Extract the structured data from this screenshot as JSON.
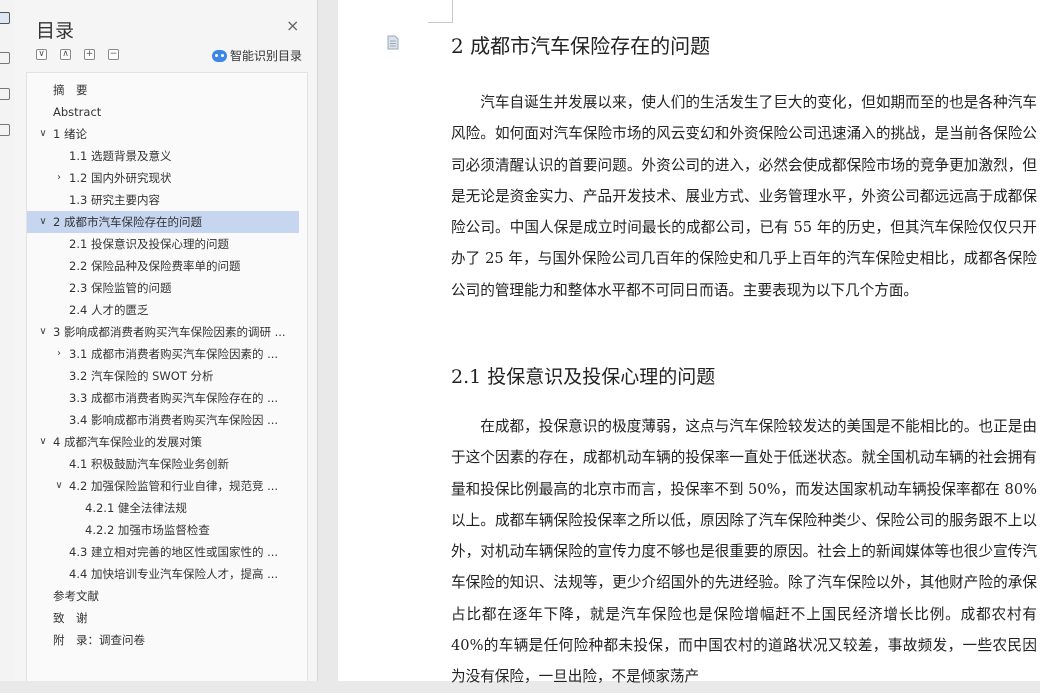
{
  "sidebar": {
    "title": "目录",
    "close_label": "×",
    "tools": [
      "∨",
      "∧",
      "+",
      "−"
    ],
    "smart_label": "智能识别目录",
    "toc": [
      {
        "label": "摘　要",
        "level": 0,
        "chevron": ""
      },
      {
        "label": "Abstract",
        "level": 0,
        "chevron": ""
      },
      {
        "label": "1 绪论",
        "level": 0,
        "chevron": "∨"
      },
      {
        "label": "1.1 选题背景及意义",
        "level": 1,
        "chevron": ""
      },
      {
        "label": "1.2 国内外研究现状",
        "level": 1,
        "chevron": "›"
      },
      {
        "label": "1.3 研究主要内容",
        "level": 1,
        "chevron": ""
      },
      {
        "label": "2 成都市汽车保险存在的问题",
        "level": 0,
        "chevron": "∨",
        "selected": true
      },
      {
        "label": "2.1 投保意识及投保心理的问题",
        "level": 1,
        "chevron": ""
      },
      {
        "label": "2.2 保险品种及保险费率单的问题",
        "level": 1,
        "chevron": ""
      },
      {
        "label": "2.3 保险监管的问题",
        "level": 1,
        "chevron": ""
      },
      {
        "label": "2.4 人才的匮乏",
        "level": 1,
        "chevron": ""
      },
      {
        "label": "3 影响成都消费者购买汽车保险因素的调研 ...",
        "level": 0,
        "chevron": "∨"
      },
      {
        "label": "3.1 成都市消费者购买汽车保险因素的 ...",
        "level": 1,
        "chevron": "›"
      },
      {
        "label": "3.2 汽车保险的 SWOT 分析",
        "level": 1,
        "chevron": ""
      },
      {
        "label": "3.3 成都市消费者购买汽车保险存在的 ...",
        "level": 1,
        "chevron": ""
      },
      {
        "label": "3.4 影响成都市消费者购买汽车保险因 ...",
        "level": 1,
        "chevron": ""
      },
      {
        "label": "4 成都汽车保险业的发展对策",
        "level": 0,
        "chevron": "∨"
      },
      {
        "label": "4.1 积极鼓励汽车保险业务创新",
        "level": 1,
        "chevron": ""
      },
      {
        "label": "4.2 加强保险监管和行业自律，规范竞 ...",
        "level": 1,
        "chevron": "∨"
      },
      {
        "label": "4.2.1 健全法律法规",
        "level": 2,
        "chevron": ""
      },
      {
        "label": "4.2.2 加强市场监督检查",
        "level": 2,
        "chevron": ""
      },
      {
        "label": "4.3 建立相对完善的地区性或国家性的 ...",
        "level": 1,
        "chevron": ""
      },
      {
        "label": "4.4 加快培训专业汽车保险人才，提高 ...",
        "level": 1,
        "chevron": ""
      },
      {
        "label": "参考文献",
        "level": 0,
        "chevron": ""
      },
      {
        "label": "致　谢",
        "level": 0,
        "chevron": ""
      },
      {
        "label": "附　录：调查问卷",
        "level": 0,
        "chevron": ""
      }
    ]
  },
  "document": {
    "heading1": "2 成都市汽车保险存在的问题",
    "para1": "汽车自诞生并发展以来，使人们的生活发生了巨大的变化，但如期而至的也是各种汽车风险。如何面对汽车保险市场的风云变幻和外资保险公司迅速涌入的挑战，是当前各保险公司必须清醒认识的首要问题。外资公司的进入，必然会使成都保险市场的竞争更加激烈，但是无论是资金实力、产品开发技术、展业方式、业务管理水平，外资公司都远远高于成都保险公司。中国人保是成立时间最长的成都公司，已有 55 年的历史，但其汽车保险仅仅只开办了 25 年，与国外保险公司几百年的保险史和几乎上百年的汽车保险史相比，成都各保险公司的管理能力和整体水平都不可同日而语。主要表现为以下几个方面。",
    "heading2": "2.1 投保意识及投保心理的问题",
    "para2": "在成都，投保意识的极度薄弱，这点与汽车保险较发达的美国是不能相比的。也正是由于这个因素的存在，成都机动车辆的投保率一直处于低迷状态。就全国机动车辆的社会拥有量和投保比例最高的北京市而言，投保率不到 50%，而发达国家机动车辆投保率都在 80%以上。成都车辆保险投保率之所以低，原因除了汽车保险种类少、保险公司的服务跟不上以外，对机动车辆保险的宣传力度不够也是很重要的原因。社会上的新闻媒体等也很少宣传汽车保险的知识、法规等，更少介绍国外的先进经验。除了汽车保险以外，其他财产险的承保占比都在逐年下降，就是汽车保险也是保险增幅赶不上国民经济增长比例。成都农村有 40%的车辆是任何险种都未投保，而中国农村的道路状况又较差，事故频发，一些农民因为没有保险，一旦出险，不是倾家荡产"
  }
}
